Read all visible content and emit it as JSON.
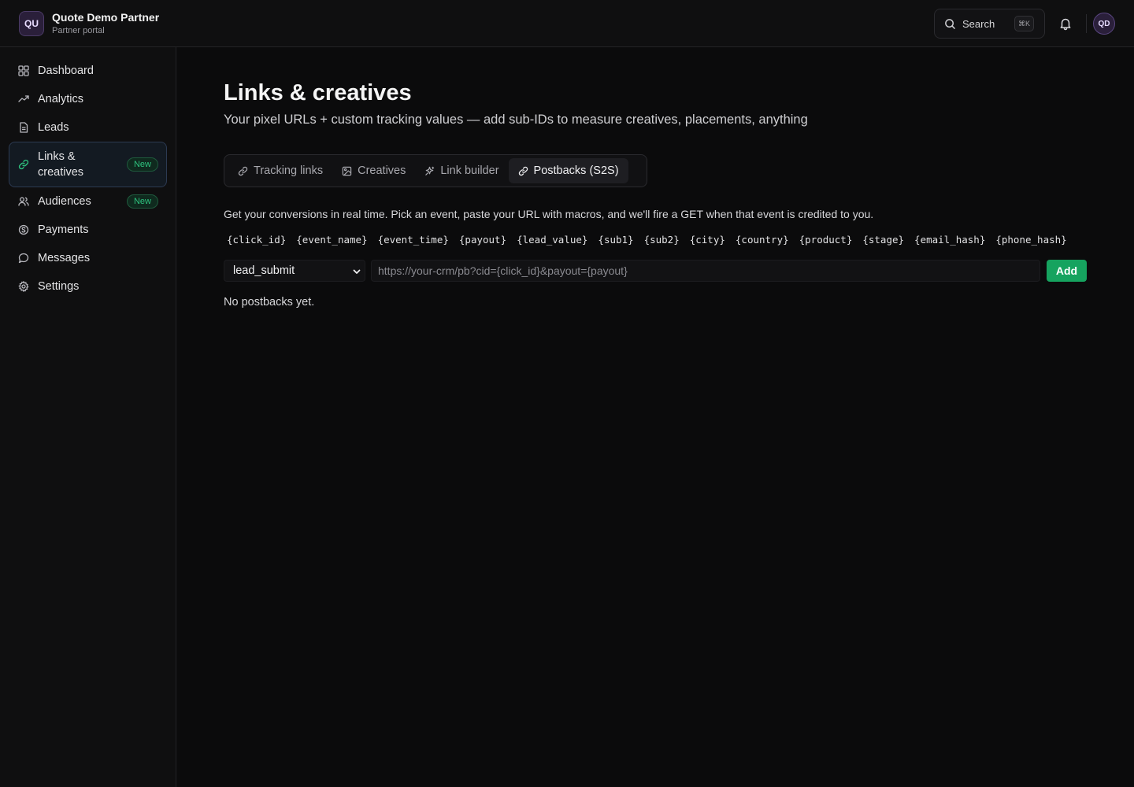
{
  "brand": {
    "initials": "QU",
    "name": "Quote Demo Partner",
    "subtitle": "Partner portal"
  },
  "header": {
    "search_label": "Search",
    "search_shortcut": "⌘K",
    "avatar_initials": "QD"
  },
  "sidebar": {
    "items": [
      {
        "label": "Dashboard",
        "icon": "dashboard-icon"
      },
      {
        "label": "Analytics",
        "icon": "trend-icon"
      },
      {
        "label": "Leads",
        "icon": "document-icon"
      },
      {
        "label": "Links & creatives",
        "icon": "link-icon",
        "badge": "New",
        "active": true
      },
      {
        "label": "Audiences",
        "icon": "users-icon",
        "badge": "New"
      },
      {
        "label": "Payments",
        "icon": "payments-icon"
      },
      {
        "label": "Messages",
        "icon": "message-icon"
      },
      {
        "label": "Settings",
        "icon": "gear-icon"
      }
    ]
  },
  "page": {
    "title": "Links & creatives",
    "subtitle": "Your pixel URLs + custom tracking values — add sub-IDs to measure creatives, placements, anything"
  },
  "tabs": [
    {
      "label": "Tracking links",
      "icon": "link-icon"
    },
    {
      "label": "Creatives",
      "icon": "image-icon"
    },
    {
      "label": "Link builder",
      "icon": "sparkle-icon"
    },
    {
      "label": "Postbacks (S2S)",
      "icon": "link-icon",
      "active": true
    }
  ],
  "postbacks": {
    "description": "Get your conversions in real time. Pick an event, paste your URL with macros, and we'll fire a GET when that event is credited to you.",
    "macros": [
      "{click_id}",
      "{event_name}",
      "{event_time}",
      "{payout}",
      "{lead_value}",
      "{sub1}",
      "{sub2}",
      "{city}",
      "{country}",
      "{product}",
      "{stage}",
      "{email_hash}",
      "{phone_hash}"
    ],
    "event_selected": "lead_submit",
    "url_placeholder": "https://your-crm/pb?cid={click_id}&payout={payout}",
    "add_label": "Add",
    "empty_text": "No postbacks yet."
  },
  "colors": {
    "accent_green": "#16a35f",
    "badge_green": "#2ec27e",
    "background": "#0b0b0c"
  }
}
